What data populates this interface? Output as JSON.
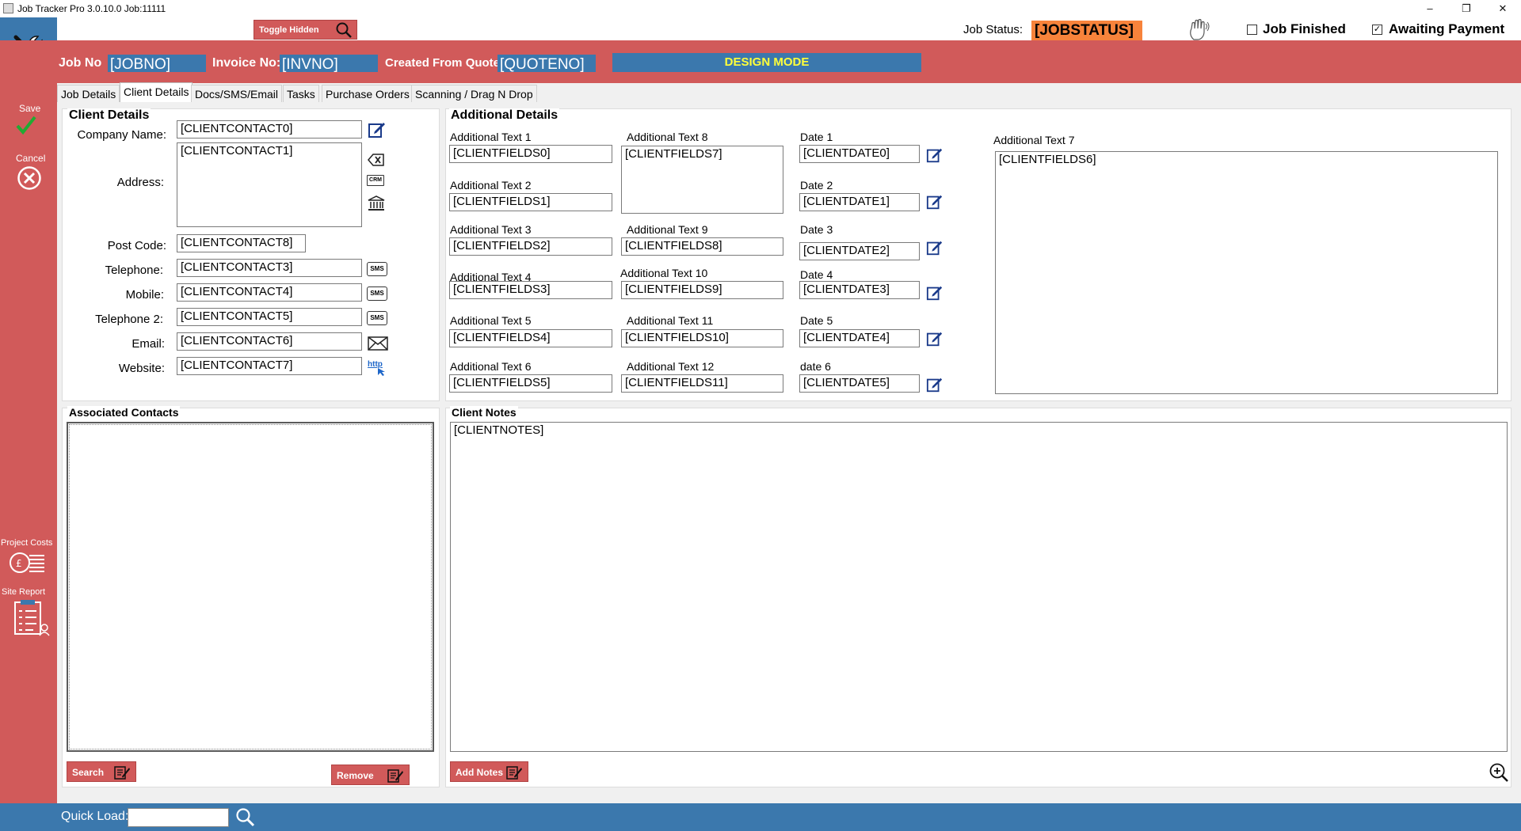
{
  "window": {
    "title": "Job Tracker Pro 3.0.10.0 Job:11111",
    "minimize": "–",
    "restore": "❐",
    "close": "✕"
  },
  "toolbar": {
    "toggle_hidden": "Toggle Hidden",
    "job_status_label": "Job Status:",
    "job_status_value": "[JOBSTATUS]",
    "job_finished_label": "Job Finished",
    "job_finished_checked": false,
    "awaiting_payment_label": "Awaiting Payment",
    "awaiting_payment_checked": true
  },
  "header": {
    "job_no_label": "Job No",
    "job_no_value": "[JOBNO]",
    "invoice_no_label": "Invoice No:",
    "invoice_no_value": "[INVNO]",
    "quote_label": "Created From Quote:",
    "quote_value": "[QUOTENO]",
    "design_mode": "DESIGN MODE"
  },
  "sidebar": {
    "save": "Save",
    "cancel": "Cancel",
    "project_costs": "Project Costs",
    "site_report": "Site Report"
  },
  "tabs": [
    {
      "label": "Job Details"
    },
    {
      "label": "Client Details",
      "active": true
    },
    {
      "label": "Docs/SMS/Email"
    },
    {
      "label": "Tasks"
    },
    {
      "label": "Purchase Orders"
    },
    {
      "label": "Scanning / Drag N Drop"
    }
  ],
  "client_details": {
    "title": "Client Details",
    "company_name_label": "Company Name:",
    "company_name_value": "[CLIENTCONTACT0]",
    "address_label": "Address:",
    "address_value": "[CLIENTCONTACT1]",
    "post_code_label": "Post Code:",
    "post_code_value": "[CLIENTCONTACT8]",
    "telephone_label": "Telephone:",
    "telephone_value": "[CLIENTCONTACT3]",
    "mobile_label": "Mobile:",
    "mobile_value": "[CLIENTCONTACT4]",
    "telephone2_label": "Telephone 2:",
    "telephone2_value": "[CLIENTCONTACT5]",
    "email_label": "Email:",
    "email_value": "[CLIENTCONTACT6]",
    "website_label": "Website:",
    "website_value": "[CLIENTCONTACT7]",
    "sms_icon_text": "SMS",
    "crm_icon_text": "CRM",
    "http_icon_text": "http"
  },
  "additional_details": {
    "title": "Additional Details",
    "col1": [
      {
        "label": "Additional Text 1",
        "value": "[CLIENTFIELDS0]"
      },
      {
        "label": "Additional Text 2",
        "value": "[CLIENTFIELDS1]"
      },
      {
        "label": "Additional Text 3",
        "value": "[CLIENTFIELDS2]"
      },
      {
        "label": "Additional Text 4",
        "value": "[CLIENTFIELDS3]"
      },
      {
        "label": "Additional Text 5",
        "value": "[CLIENTFIELDS4]"
      },
      {
        "label": "Additional Text 6",
        "value": "[CLIENTFIELDS5]"
      }
    ],
    "col2": [
      {
        "label": "Additional Text 8",
        "value": "[CLIENTFIELDS7]"
      },
      {
        "label": "Additional Text 9",
        "value": "[CLIENTFIELDS8]"
      },
      {
        "label": "Additional Text 10",
        "value": "[CLIENTFIELDS9]"
      },
      {
        "label": "Additional Text 11",
        "value": "[CLIENTFIELDS10]"
      },
      {
        "label": "Additional Text 12",
        "value": "[CLIENTFIELDS11]"
      }
    ],
    "dates": [
      {
        "label": "Date 1",
        "value": "[CLIENTDATE0]"
      },
      {
        "label": "Date 2",
        "value": "[CLIENTDATE1]"
      },
      {
        "label": "Date 3",
        "value": "[CLIENTDATE2]"
      },
      {
        "label": "Date 4",
        "value": "[CLIENTDATE3]"
      },
      {
        "label": "Date 5",
        "value": "[CLIENTDATE4]"
      },
      {
        "label": "date 6",
        "value": "[CLIENTDATE5]"
      }
    ],
    "text7_label": "Additional Text 7",
    "text7_value": "[CLIENTFIELDS6]"
  },
  "associated_contacts": {
    "title": "Associated Contacts",
    "search": "Search",
    "remove": "Remove"
  },
  "client_notes": {
    "title": "Client Notes",
    "value": "[CLIENTNOTES]",
    "add_notes": "Add Notes"
  },
  "bottom": {
    "quick_load_label": "Quick Load:",
    "quick_load_value": ""
  },
  "colors": {
    "red": "#d15a5a",
    "blue": "#3b78ad",
    "status_orange": "#f7833b",
    "design_yellow": "#ffff3a"
  }
}
